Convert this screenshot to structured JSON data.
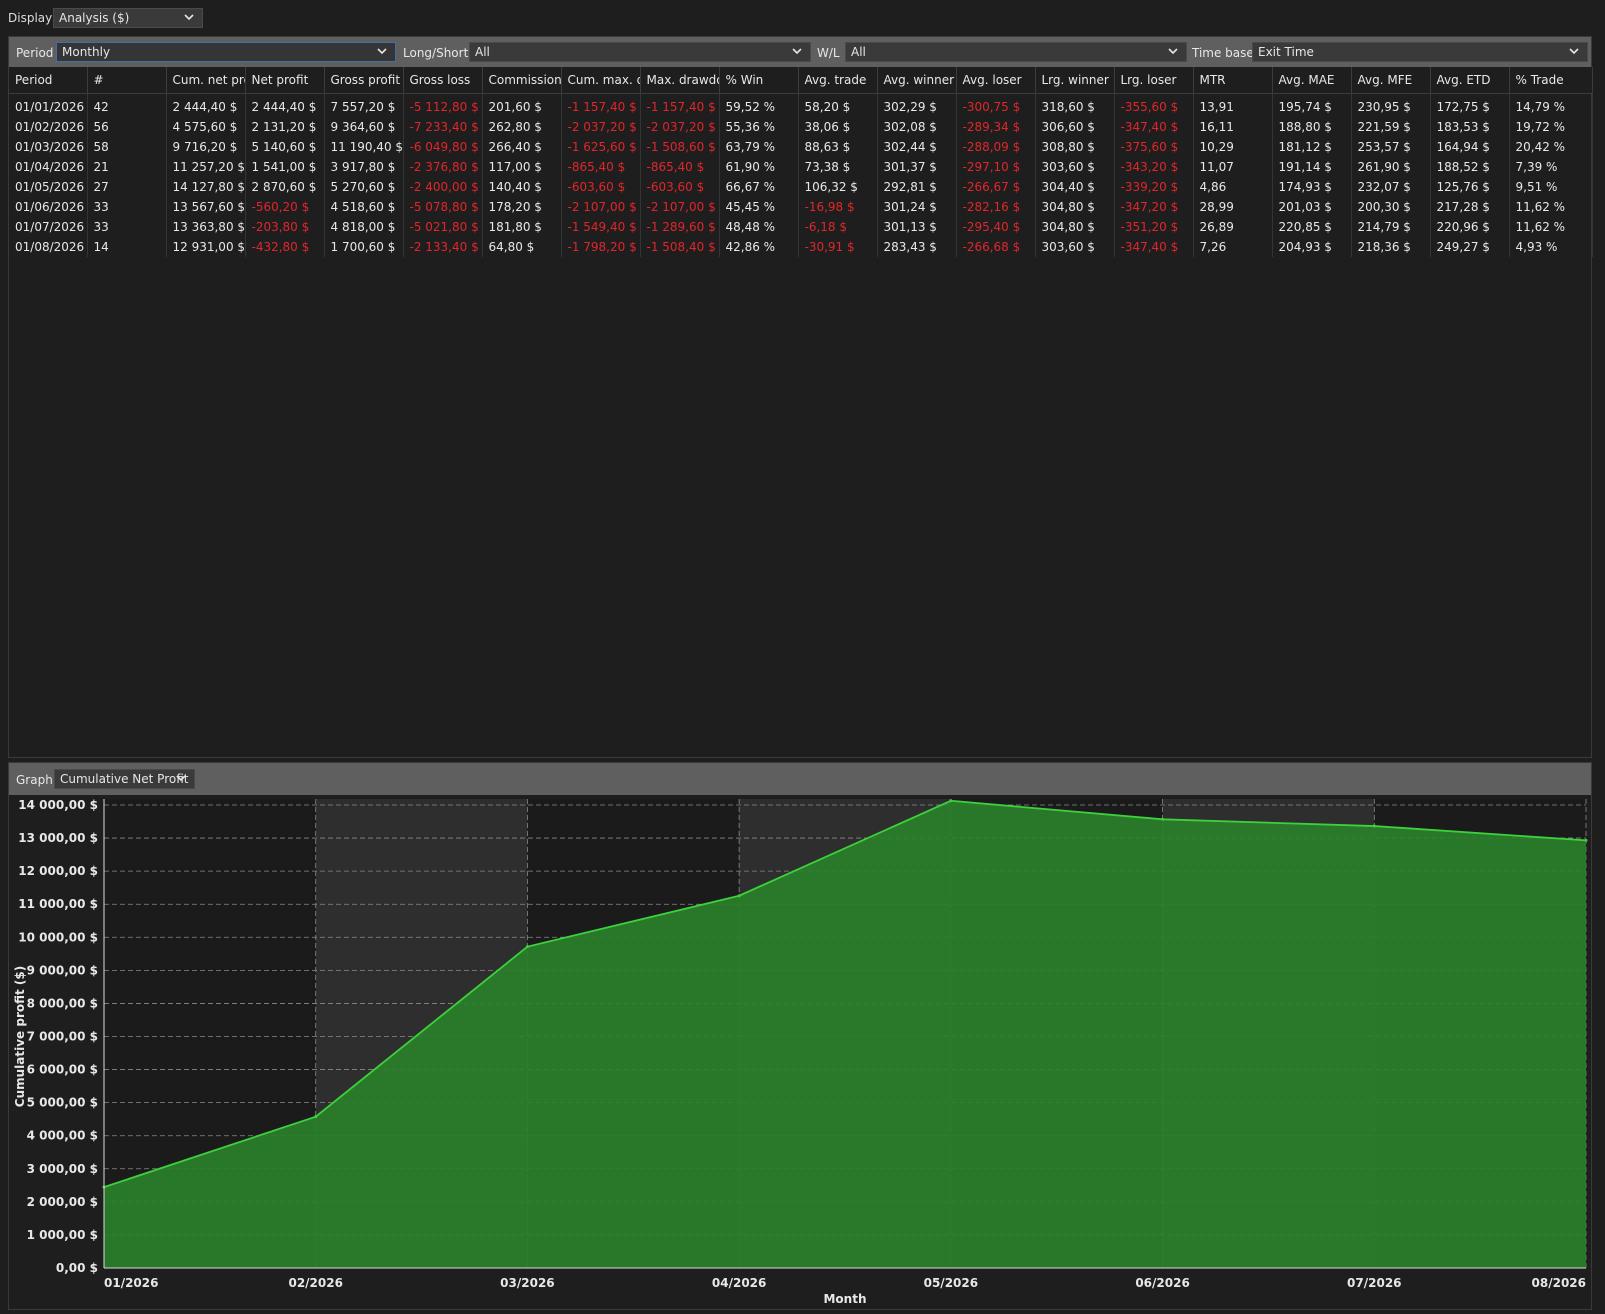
{
  "display": {
    "label": "Display",
    "value": "Analysis ($)"
  },
  "filters": {
    "period": {
      "label": "Period",
      "value": "Monthly"
    },
    "long_short": {
      "label": "Long/Short",
      "value": "All"
    },
    "wl": {
      "label": "W/L",
      "value": "All"
    },
    "time_base": {
      "label": "Time base",
      "value": "Exit Time"
    }
  },
  "table": {
    "columns": [
      "Period",
      "#",
      "Cum. net pro",
      "Net profit",
      "Gross profit",
      "Gross loss",
      "Commission",
      "Cum. max. dr",
      "Max. drawdo",
      "% Win",
      "Avg. trade",
      "Avg. winner",
      "Avg. loser",
      "Lrg. winner",
      "Lrg. loser",
      "MTR",
      "Avg. MAE",
      "Avg. MFE",
      "Avg. ETD",
      "% Trade"
    ],
    "rows": [
      [
        "01/01/2026",
        "42",
        "2 444,40 $",
        "2 444,40 $",
        "7 557,20 $",
        "-5 112,80 $",
        "201,60 $",
        "-1 157,40 $",
        "-1 157,40 $",
        "59,52 %",
        "58,20 $",
        "302,29 $",
        "-300,75 $",
        "318,60 $",
        "-355,60 $",
        "13,91",
        "195,74 $",
        "230,95 $",
        "172,75 $",
        "14,79 %"
      ],
      [
        "01/02/2026",
        "56",
        "4 575,60 $",
        "2 131,20 $",
        "9 364,60 $",
        "-7 233,40 $",
        "262,80 $",
        "-2 037,20 $",
        "-2 037,20 $",
        "55,36 %",
        "38,06 $",
        "302,08 $",
        "-289,34 $",
        "306,60 $",
        "-347,40 $",
        "16,11",
        "188,80 $",
        "221,59 $",
        "183,53 $",
        "19,72 %"
      ],
      [
        "01/03/2026",
        "58",
        "9 716,20 $",
        "5 140,60 $",
        "11 190,40 $",
        "-6 049,80 $",
        "266,40 $",
        "-1 625,60 $",
        "-1 508,60 $",
        "63,79 %",
        "88,63 $",
        "302,44 $",
        "-288,09 $",
        "308,80 $",
        "-375,60 $",
        "10,29",
        "181,12 $",
        "253,57 $",
        "164,94 $",
        "20,42 %"
      ],
      [
        "01/04/2026",
        "21",
        "11 257,20 $",
        "1 541,00 $",
        "3 917,80 $",
        "-2 376,80 $",
        "117,00 $",
        "-865,40 $",
        "-865,40 $",
        "61,90 %",
        "73,38 $",
        "301,37 $",
        "-297,10 $",
        "303,60 $",
        "-343,20 $",
        "11,07",
        "191,14 $",
        "261,90 $",
        "188,52 $",
        "7,39 %"
      ],
      [
        "01/05/2026",
        "27",
        "14 127,80 $",
        "2 870,60 $",
        "5 270,60 $",
        "-2 400,00 $",
        "140,40 $",
        "-603,60 $",
        "-603,60 $",
        "66,67 %",
        "106,32 $",
        "292,81 $",
        "-266,67 $",
        "304,40 $",
        "-339,20 $",
        "4,86",
        "174,93 $",
        "232,07 $",
        "125,76 $",
        "9,51 %"
      ],
      [
        "01/06/2026",
        "33",
        "13 567,60 $",
        "-560,20 $",
        "4 518,60 $",
        "-5 078,80 $",
        "178,20 $",
        "-2 107,00 $",
        "-2 107,00 $",
        "45,45 %",
        "-16,98 $",
        "301,24 $",
        "-282,16 $",
        "304,80 $",
        "-347,20 $",
        "28,99",
        "201,03 $",
        "200,30 $",
        "217,28 $",
        "11,62 %"
      ],
      [
        "01/07/2026",
        "33",
        "13 363,80 $",
        "-203,80 $",
        "4 818,00 $",
        "-5 021,80 $",
        "181,80 $",
        "-1 549,40 $",
        "-1 289,60 $",
        "48,48 %",
        "-6,18 $",
        "301,13 $",
        "-295,40 $",
        "304,80 $",
        "-351,20 $",
        "26,89",
        "220,85 $",
        "214,79 $",
        "220,96 $",
        "11,62 %"
      ],
      [
        "01/08/2026",
        "14",
        "12 931,00 $",
        "-432,80 $",
        "1 700,60 $",
        "-2 133,40 $",
        "64,80 $",
        "-1 798,20 $",
        "-1 508,40 $",
        "42,86 %",
        "-30,91 $",
        "283,43 $",
        "-266,68 $",
        "303,60 $",
        "-347,40 $",
        "7,26",
        "204,93 $",
        "218,36 $",
        "249,27 $",
        "4,93 %"
      ]
    ]
  },
  "graph": {
    "label": "Graph",
    "value": "Cumulative Net Profit"
  },
  "chart_data": {
    "type": "area",
    "x": [
      "01/2026",
      "02/2026",
      "03/2026",
      "04/2026",
      "05/2026",
      "06/2026",
      "07/2026",
      "08/2026"
    ],
    "values": [
      2444.4,
      4575.6,
      9716.2,
      11257.2,
      14127.8,
      13567.6,
      13363.8,
      12931.0
    ],
    "xlabel": "Month",
    "ylabel": "Cumulative profit ($)",
    "ylim": [
      0,
      14000
    ],
    "yticks": [
      "0,00 $",
      "1 000,00 $",
      "2 000,00 $",
      "3 000,00 $",
      "4 000,00 $",
      "5 000,00 $",
      "6 000,00 $",
      "7 000,00 $",
      "8 000,00 $",
      "9 000,00 $",
      "10 000,00 $",
      "11 000,00 $",
      "12 000,00 $",
      "13 000,00 $",
      "14 000,00 $"
    ],
    "grid": true,
    "colors": {
      "fill": "#2a7f2a",
      "line": "#3dd13d",
      "band": "#2e2e2e",
      "background": "#1b1b1b"
    }
  }
}
